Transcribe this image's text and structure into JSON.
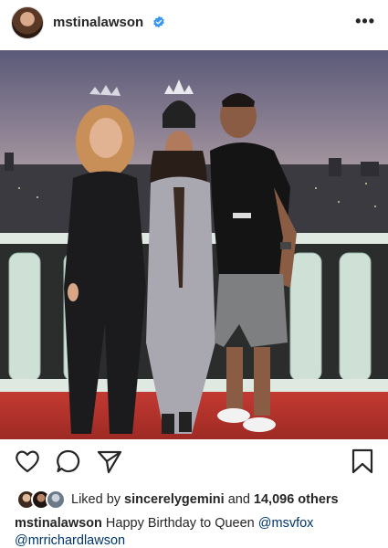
{
  "header": {
    "username": "mstinalawson",
    "verified": true,
    "avatar_icon": "profile-avatar",
    "more_icon": "more-horizontal-icon"
  },
  "post": {
    "image_icon": "photo-content",
    "actions": {
      "like_icon": "heart-icon",
      "comment_icon": "comment-icon",
      "share_icon": "paper-plane-icon",
      "save_icon": "bookmark-icon"
    },
    "likes": {
      "prefix": "Liked by",
      "liker": "sincerelygemini",
      "middle": "and",
      "others": "14,096 others"
    },
    "caption": {
      "author": "mstinalawson",
      "text": "Happy Birthday to Queen",
      "mention1": "@msvfox",
      "mention2": "@mrrichardlawson"
    }
  },
  "colors": {
    "text": "#262626",
    "verified_blue": "#3897f0",
    "mention": "#003569"
  }
}
